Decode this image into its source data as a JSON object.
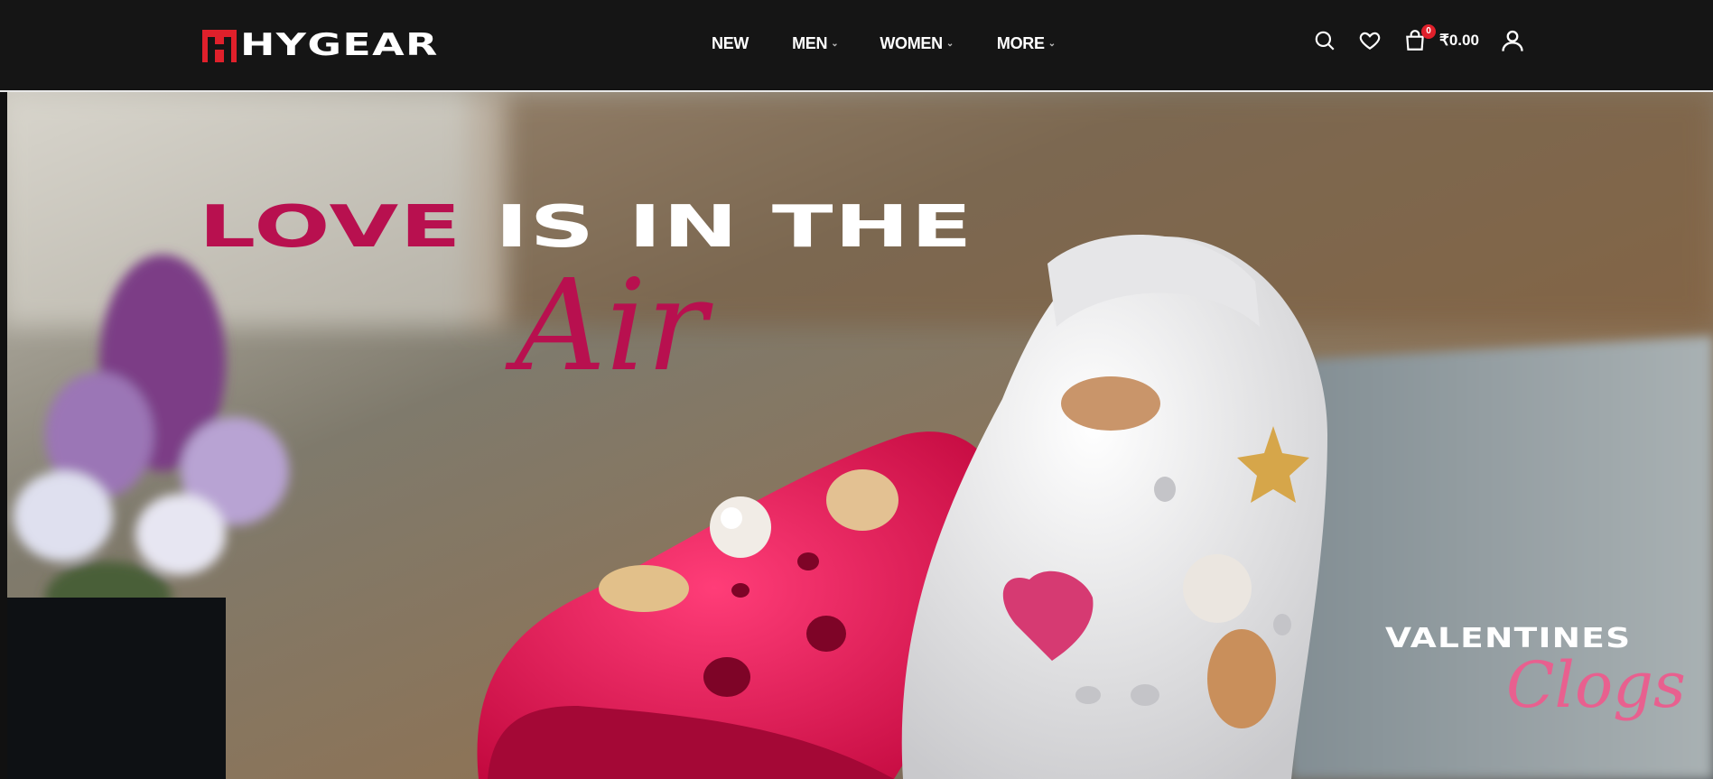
{
  "brand": {
    "name": "HYGEAR"
  },
  "nav": {
    "items": [
      {
        "label": "NEW",
        "has_dropdown": false
      },
      {
        "label": "MEN",
        "has_dropdown": true
      },
      {
        "label": "WOMEN",
        "has_dropdown": true
      },
      {
        "label": "MORE",
        "has_dropdown": true
      }
    ]
  },
  "header_icons": {
    "search": "search-icon",
    "wishlist": "heart-icon",
    "cart": "shopping-bag-icon",
    "account": "user-icon"
  },
  "cart": {
    "count": "0",
    "total": "₹0.00"
  },
  "hero": {
    "headline_love": "LOVE",
    "headline_rest": "IS IN THE",
    "headline_script": "Air",
    "promo_title": "VALENTINES",
    "promo_script": "Clogs"
  },
  "colors": {
    "accent": "#b8104f",
    "header_bg": "#151515",
    "badge": "#e0202b",
    "script_pink": "#e8608f"
  }
}
